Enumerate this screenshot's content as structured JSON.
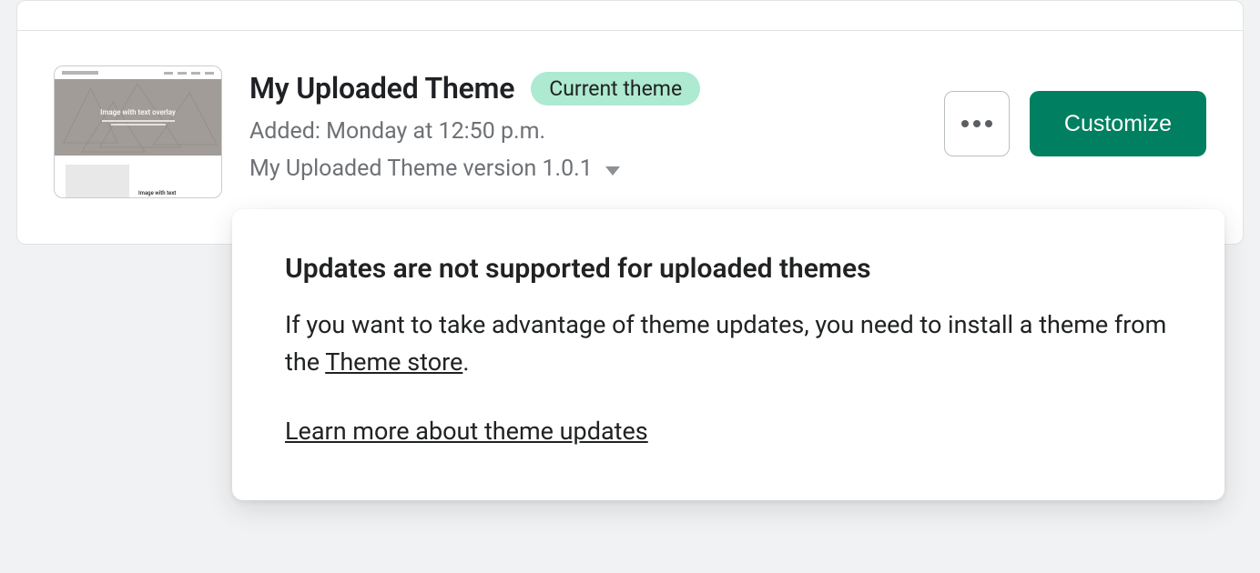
{
  "theme": {
    "name": "My Uploaded Theme",
    "badge": "Current theme",
    "added_label": "Added: Monday at 12:50 p.m.",
    "version_label": "My Uploaded Theme version 1.0.1"
  },
  "thumbnail": {
    "hero_text": "Image with text overlay",
    "lower_text": "Image with text"
  },
  "actions": {
    "customize": "Customize"
  },
  "popover": {
    "heading": "Updates are not supported for uploaded themes",
    "body_pre": "If you want to take advantage of theme updates, you need to install a theme from the ",
    "store_link": "Theme store",
    "body_post": ".",
    "learn_link": "Learn more about theme updates"
  }
}
